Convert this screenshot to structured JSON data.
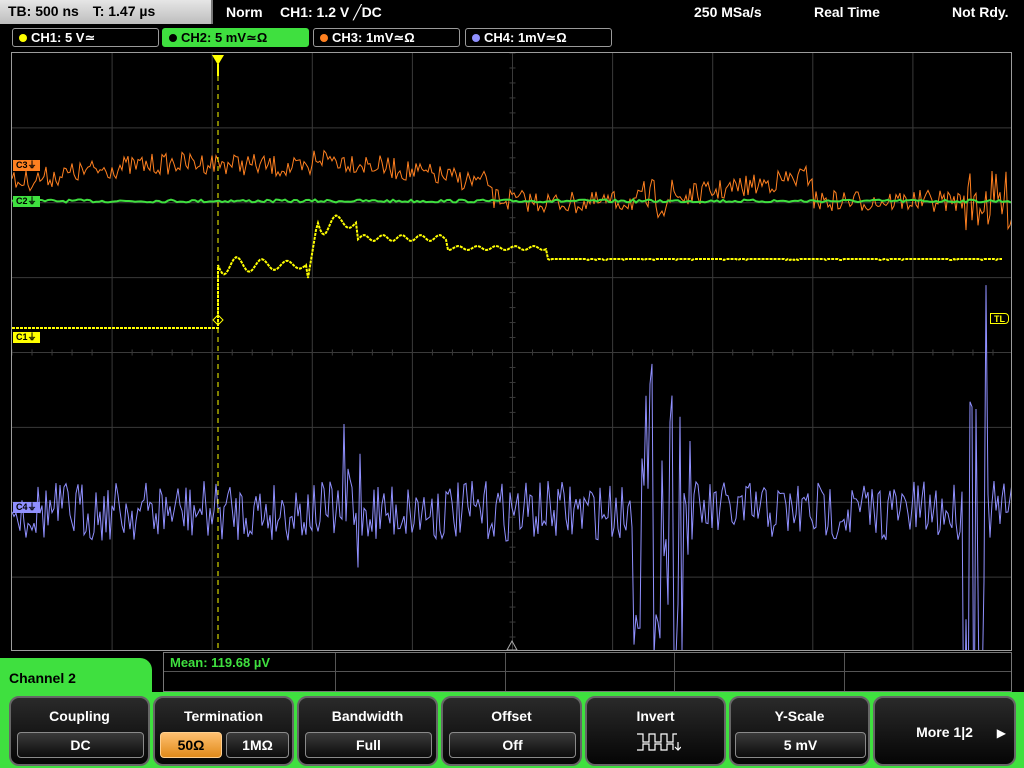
{
  "status": {
    "tb": "TB: 500 ns",
    "t": "T: 1.47 µs",
    "trigger_mode": "Norm",
    "trigger_info": "CH1: 1.2 V ╱DC",
    "sample_rate": "250 MSa/s",
    "acq_mode": "Real Time",
    "state": "Not Rdy."
  },
  "channel_tabs": [
    {
      "label": "CH1: 5 V≃",
      "color": "#ffff00"
    },
    {
      "label": "CH2: 5 mV≃Ω",
      "color": "#3fe03f"
    },
    {
      "label": "CH3: 1mV≃Ω",
      "color": "#ff8020"
    },
    {
      "label": "CH4: 1mV≃Ω",
      "color": "#9090ff"
    }
  ],
  "markers": {
    "c3": "C3⏚",
    "c2": "C2⏚",
    "c1": "C1⏚",
    "c4": "C4⏚",
    "tl": "TL"
  },
  "measurement": {
    "text": "Mean: 119.68 µV"
  },
  "panel": {
    "title": "Channel 2"
  },
  "softkeys": {
    "coupling": {
      "title": "Coupling",
      "value": "DC"
    },
    "termination": {
      "title": "Termination",
      "opt1": "50Ω",
      "opt2": "1MΩ",
      "selected": "50Ω"
    },
    "bandwidth": {
      "title": "Bandwidth",
      "value": "Full"
    },
    "offset": {
      "title": "Offset",
      "value": "Off"
    },
    "invert": {
      "title": "Invert"
    },
    "yscale": {
      "title": "Y-Scale",
      "value": "5 mV"
    },
    "more": {
      "label": "More 1|2"
    }
  },
  "colors": {
    "ch1": "#ffff00",
    "ch2": "#3fe03f",
    "ch3": "#ff8020",
    "ch4": "#9090ff",
    "accent": "#3fe03f",
    "selected": "#f0a040"
  }
}
